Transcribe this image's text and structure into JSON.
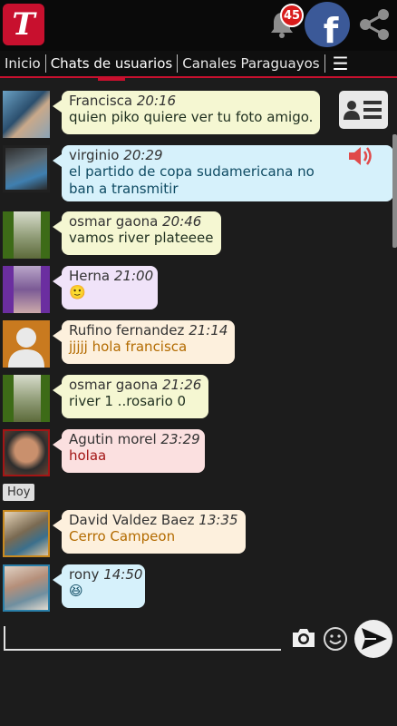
{
  "header": {
    "logo_letter": "T",
    "notifications_count": "45",
    "facebook_letter": "f"
  },
  "tabs": [
    {
      "label": "Inicio"
    },
    {
      "label": "Chats de usuarios"
    },
    {
      "label": "Canales Paraguayos"
    }
  ],
  "day_label": "Hoy",
  "messages": [
    {
      "name": "Francisca",
      "time": "20:16",
      "text": "quien piko quiere ver tu foto amigo.",
      "bubble_color": "#f5f7d2",
      "text_color": "#1f2f1f"
    },
    {
      "name": "virginio",
      "time": "20:29",
      "text_lines": [
        "el partido de copa sudamericana no",
        "ban a transmitir"
      ],
      "bubble_color": "#d6f1fb",
      "text_color": "#0f4b63"
    },
    {
      "name": "osmar gaona",
      "time": "20:46",
      "text": "vamos river plateeee",
      "bubble_color": "#f5f7d2",
      "text_color": "#1f2f1f"
    },
    {
      "name": "Herna",
      "time": "21:00",
      "text": "🙂",
      "bubble_color": "#f0e3f9",
      "text_color": "#4b2766"
    },
    {
      "name": "Rufino fernandez",
      "time": "21:14",
      "text": "jjjjj hola francisca",
      "bubble_color": "#fdf0dd",
      "text_color": "#b36b00"
    },
    {
      "name": "osmar gaona",
      "time": "21:26",
      "text": "river 1 ..rosario 0",
      "bubble_color": "#f5f7d2",
      "text_color": "#1f2f1f"
    },
    {
      "name": "Agutin morel",
      "time": "23:29",
      "text": "holaa",
      "bubble_color": "#fbe0e0",
      "text_color": "#a31515"
    },
    {
      "name": "David Valdez Baez",
      "time": "13:35",
      "text": "Cerro Campeon",
      "bubble_color": "#fdf0dd",
      "text_color": "#b36b00"
    },
    {
      "name": "rony",
      "time": "14:50",
      "text": "😆",
      "bubble_color": "#d6f1fb",
      "text_color": "#0f4b63"
    }
  ],
  "colors": {
    "accent": "#c8102e",
    "facebook": "#3b5998",
    "badge": "#d81b1b"
  }
}
